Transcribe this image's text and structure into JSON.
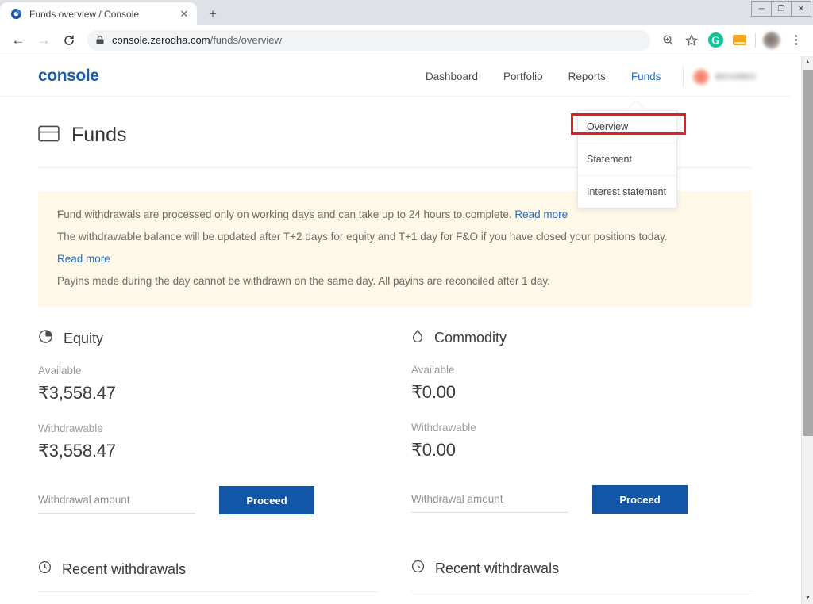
{
  "browser": {
    "tab": {
      "title": "Funds overview / Console",
      "favicon_icon": "console-logo-icon",
      "close_icon": "close-icon"
    },
    "new_tab_icon": "plus-icon",
    "window_controls": [
      {
        "name": "minimize",
        "glyph": "—"
      },
      {
        "name": "restore",
        "glyph": "❐"
      },
      {
        "name": "close",
        "glyph": "✕"
      }
    ],
    "nav": {
      "back_icon": "arrow-left-icon",
      "forward_icon": "arrow-right-icon",
      "reload_icon": "reload-icon"
    },
    "omnibox": {
      "lock_icon": "lock-icon",
      "url_domain": "console.zerodha.com",
      "url_path": "/funds/overview"
    },
    "toolbar_icons": [
      {
        "name": "zoom-icon",
        "glyph": "⌕"
      },
      {
        "name": "bookmark-star-icon",
        "glyph": "☆"
      },
      {
        "name": "grammarly-extension-icon",
        "label": "G"
      },
      {
        "name": "extension-orange-icon",
        "label": ""
      },
      {
        "name": "profile-avatar",
        "label": ""
      },
      {
        "name": "chrome-menu-icon",
        "label": ""
      }
    ]
  },
  "console": {
    "logo": "console",
    "nav_links": [
      {
        "label": "Dashboard",
        "active": false
      },
      {
        "label": "Portfolio",
        "active": false
      },
      {
        "label": "Reports",
        "active": false
      },
      {
        "label": "Funds",
        "active": true
      }
    ],
    "dropdown": {
      "items": [
        {
          "label": "Overview",
          "highlighted": true
        },
        {
          "label": "Statement",
          "highlighted": false
        },
        {
          "label": "Interest statement",
          "highlighted": false
        }
      ],
      "highlight_color": "#e02020"
    }
  },
  "page": {
    "title": "Funds",
    "title_icon": "card-icon",
    "notice": {
      "line1_text": "Fund withdrawals are processed only on working days and can take up to 24 hours to complete.",
      "line1_link": "Read more",
      "line2_text": "The withdrawable balance will be updated after T+2 days for equity and T+1 day for F&O if you have closed your positions today.",
      "line2_link": "Read more",
      "line3_text": "Payins made during the day cannot be withdrawn on the same day. All payins are reconciled after 1 day.",
      "background_color": "#fdf8e8"
    },
    "segments": [
      {
        "name": "Equity",
        "icon": "pie-chart-icon",
        "available_label": "Available",
        "available_value": "₹3,558.47",
        "withdrawable_label": "Withdrawable",
        "withdrawable_value": "₹3,558.47",
        "input_placeholder": "Withdrawal amount",
        "input_value": "",
        "button_label": "Proceed",
        "recent_label": "Recent withdrawals",
        "recent_icon": "clock-icon"
      },
      {
        "name": "Commodity",
        "icon": "droplet-icon",
        "available_label": "Available",
        "available_value": "₹0.00",
        "withdrawable_label": "Withdrawable",
        "withdrawable_value": "₹0.00",
        "input_placeholder": "Withdrawal amount",
        "input_value": "",
        "button_label": "Proceed",
        "recent_label": "Recent withdrawals",
        "recent_icon": "clock-icon"
      }
    ],
    "accent_color": "#1256a8",
    "link_color": "#2a6cc4"
  },
  "scrollbar": {
    "up_icon": "chevron-up-icon",
    "down_icon": "chevron-down-icon"
  }
}
